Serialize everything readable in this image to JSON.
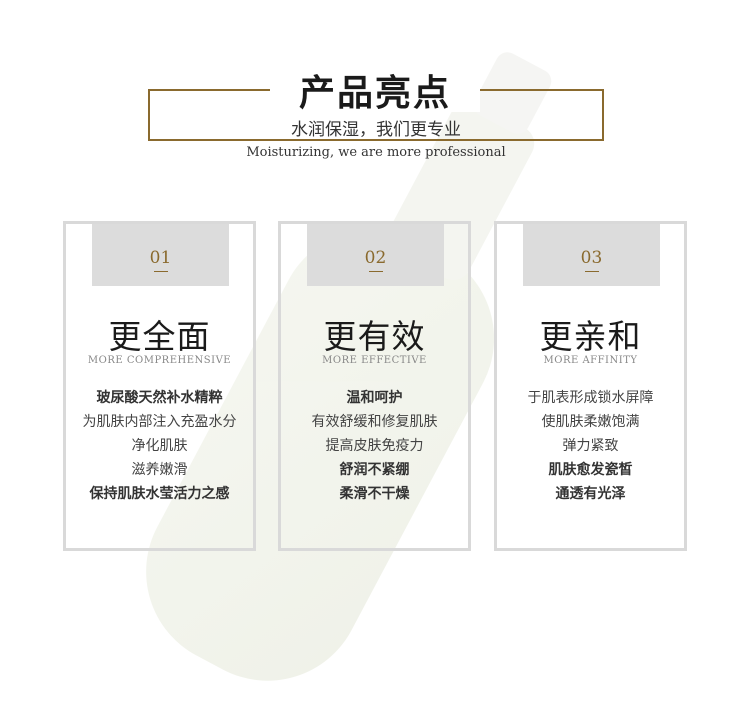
{
  "header": {
    "title": "产品亮点",
    "subtitle": "水润保湿，我们更专业",
    "english": "Moisturizing, we are more professional"
  },
  "cards": [
    {
      "number": "01",
      "title": "更全面",
      "subtitle": "MORE COMPREHENSIVE",
      "items": [
        "玻尿酸天然补水精粹",
        "为肌肤内部注入充盈水分",
        "净化肌肤",
        "滋养嫩滑",
        "保持肌肤水莹活力之感"
      ]
    },
    {
      "number": "02",
      "title": "更有效",
      "subtitle": "MORE EFFECTIVE",
      "items": [
        "温和呵护",
        "有效舒缓和修复肌肤",
        "提高皮肤免疫力",
        "舒润不紧绷",
        "柔滑不干燥"
      ]
    },
    {
      "number": "03",
      "title": "更亲和",
      "subtitle": "MORE AFFINITY",
      "items": [
        "于肌表形成锁水屏障",
        "使肌肤柔嫩饱满",
        "弹力紧致",
        "肌肤愈发瓷皙",
        "通透有光泽"
      ]
    }
  ],
  "colors": {
    "accent": "#8a6a2e",
    "card_border": "#d9d9d9",
    "number_box": "#dcdcdc"
  }
}
